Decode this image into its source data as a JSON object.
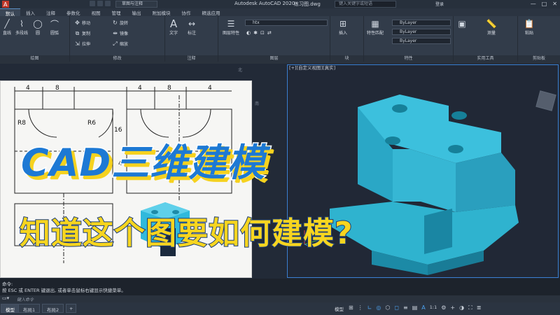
{
  "titlebar": {
    "workspace": "草图与注释",
    "app_title": "Autodesk AutoCAD 2020",
    "file_title": "练习图.dwg",
    "search_placeholder": "键入关键字或短语",
    "login": "登录",
    "min_icon": "minimize-icon",
    "max_icon": "maximize-icon",
    "close_icon": "close-icon"
  },
  "ribbon_tabs": [
    "默认",
    "插入",
    "注释",
    "参数化",
    "视图",
    "管理",
    "输出",
    "附加模块",
    "协作",
    "精选应用"
  ],
  "active_tab": "默认",
  "panels": {
    "draw": {
      "label": "绘图",
      "tools": [
        "直线",
        "多段线",
        "圆",
        "圆弧"
      ]
    },
    "modify": {
      "label": "修改",
      "tools": [
        "移动",
        "旋转",
        "复制",
        "镜像",
        "拉伸",
        "缩放"
      ]
    },
    "annotation": {
      "label": "注释",
      "tools": [
        "文字",
        "标注"
      ]
    },
    "layers": {
      "label": "图层",
      "tools": [
        "图层特性"
      ],
      "current_layer": "htx"
    },
    "block": {
      "label": "块",
      "tools": [
        "插入"
      ]
    },
    "properties": {
      "label": "特性",
      "tools": [
        "特性匹配"
      ],
      "color": "ByLayer",
      "linetype": "ByLayer",
      "lineweight": "ByLayer"
    },
    "utilities": {
      "label": "实用工具",
      "tools": [
        "测量"
      ]
    },
    "clipboard": {
      "label": "剪贴板",
      "tools": [
        "粘贴"
      ]
    }
  },
  "viewport": {
    "label": "[+][自定义视图][真实]",
    "compass_north": "北",
    "compass_south": "南"
  },
  "overlay": {
    "headline": "CAD三维建模",
    "subline": "知道这个图要如何建模?"
  },
  "drawing_dims": [
    "4",
    "8",
    "4",
    "8",
    "4",
    "R8",
    "R6",
    "16",
    "4"
  ],
  "command": {
    "line1": "命令:",
    "line2": "按 ESC 或 ENTER 键退出, 或者单击鼠标右键显示快捷菜单。",
    "input_placeholder": "键入命令"
  },
  "status": {
    "layout_tabs": [
      "模型",
      "布局1",
      "布局2"
    ],
    "active_layout": "模型",
    "model_label": "模型",
    "scale": "1:1",
    "add_tab": "+"
  },
  "colors": {
    "model_fill": "#2fb3cf",
    "model_shadow": "#1c8aa6",
    "headline": "#1d79d4",
    "headline_shadow": "#f6d21f",
    "subline": "#f7d51f",
    "viewport_border": "#3a7fd0"
  }
}
